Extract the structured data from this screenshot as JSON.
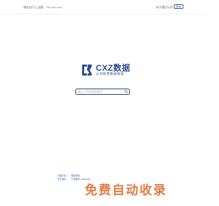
{
  "header": {
    "note": "域名出行 仁出售",
    "site": "TXZ.xxx.com",
    "about_label": "关于我们公司",
    "login_label": "登录"
  },
  "brand": {
    "title": "CXZ数据",
    "subtitle": "公司经营数据探索",
    "color": "#2a4f8f"
  },
  "search": {
    "placeholder": "输入公司名称关键字"
  },
  "footer": {
    "col1": [
      "中国平台",
      "关于我们"
    ],
    "col2": [
      "使用规则",
      "产品服务"
    ],
    "col3": [
      "",
      "cxzsj.com"
    ],
    "promo_text": "免费自动收录"
  }
}
